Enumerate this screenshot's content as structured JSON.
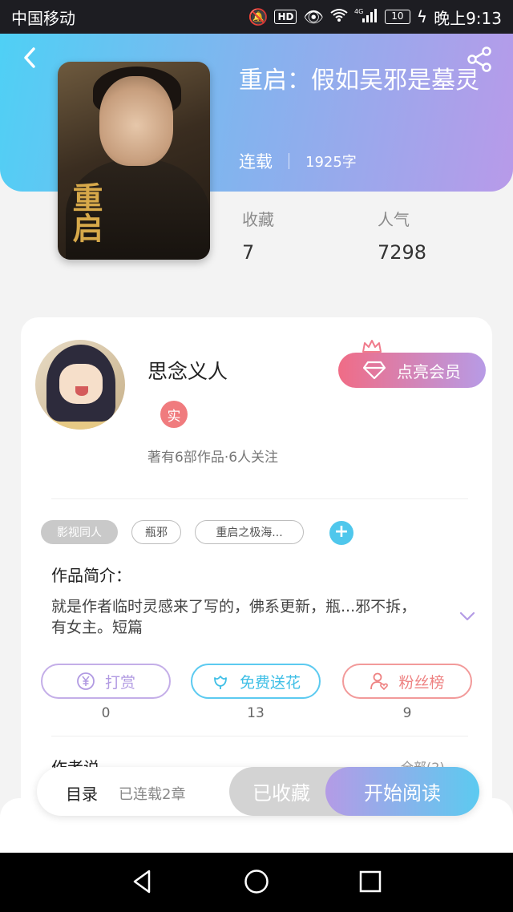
{
  "status_bar": {
    "carrier": "中国移动",
    "network": "4G",
    "hd": "HD",
    "battery": "10",
    "time": "晚上9:13"
  },
  "book": {
    "title": "重启：假如吴邪是墓灵",
    "status": "连载",
    "word_count": "1925字",
    "cover_seal_text": "重启",
    "stats": [
      {
        "label": "收藏",
        "value": "7"
      },
      {
        "label": "人气",
        "value": "7298"
      }
    ]
  },
  "author": {
    "name": "思念义人",
    "badge": "实",
    "info": "著有6部作品·6人关注",
    "vip_button": "点亮会员"
  },
  "tags": [
    "影视同人",
    "瓶邪",
    "重启之极海..."
  ],
  "intro": {
    "title": "作品简介：",
    "text": "就是作者临时灵感来了写的，佛系更新，瓶...邪不拆，有女主。短篇"
  },
  "actions": [
    {
      "label": "打赏",
      "count": "0",
      "color": "#b9a0e4"
    },
    {
      "label": "免费送花",
      "count": "13",
      "color": "#47c6e9"
    },
    {
      "label": "粉丝榜",
      "count": "9",
      "color": "#f08c8c"
    }
  ],
  "peek": {
    "title": "作者说",
    "right": "全部(2)"
  },
  "bottom_bar": {
    "toc_label": "目录",
    "toc_sub": "已连载2章",
    "favorite": "已收藏",
    "read": "开始阅读"
  },
  "colors": {
    "header_gradient": [
      "#4fd0f5",
      "#b89ae9"
    ],
    "vip_gradient": [
      "#f06c86",
      "#b79be6"
    ],
    "accent_blue": "#4fc7ec"
  }
}
